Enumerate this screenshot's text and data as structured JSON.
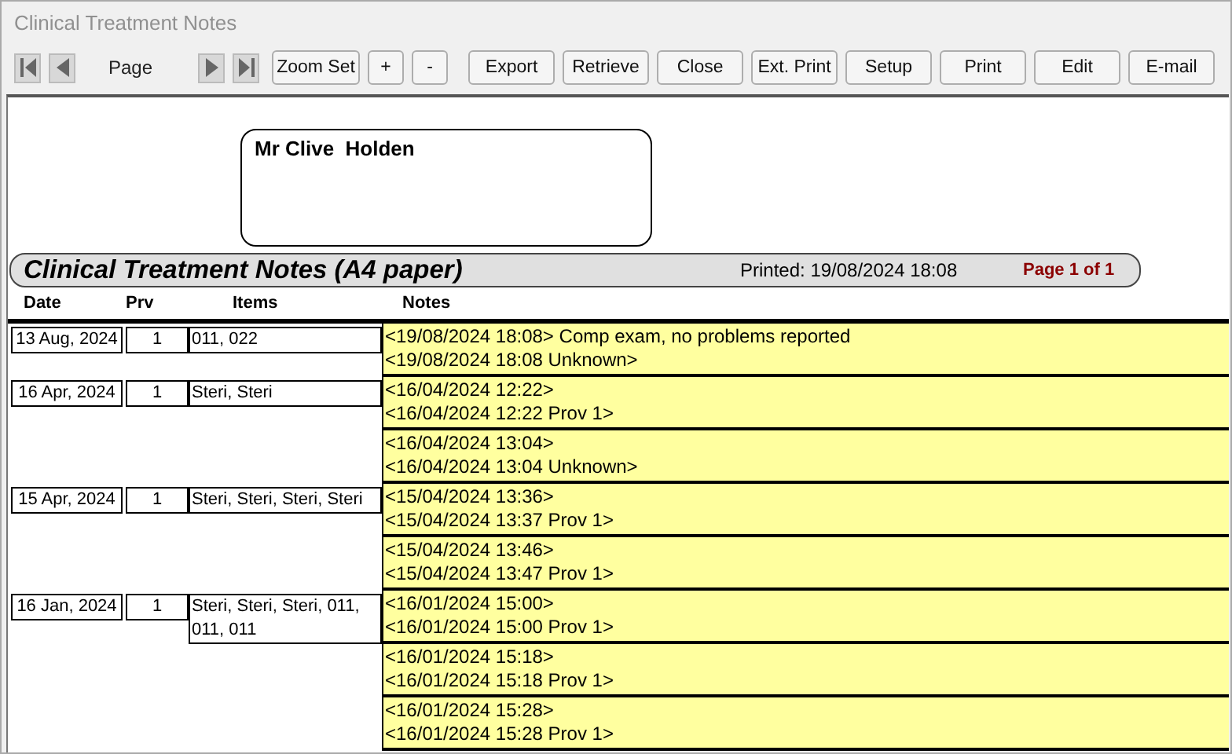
{
  "window": {
    "title": "Clinical Treatment Notes"
  },
  "toolbar": {
    "page_label": "Page",
    "zoom_buttons": [
      "Zoom Set",
      "+",
      "-"
    ],
    "buttons": [
      "Export",
      "Retrieve",
      "Close",
      "Ext. Print",
      "Setup",
      "Print",
      "Edit",
      "E-mail"
    ]
  },
  "patient": {
    "name": "Mr Clive  Holden"
  },
  "report": {
    "title": "Clinical Treatment Notes (A4 paper)",
    "printed": "Printed: 19/08/2024 18:08",
    "page": "Page 1 of 1"
  },
  "table": {
    "columns": [
      "Date",
      "Prv",
      "Items",
      "Notes"
    ],
    "rows": [
      {
        "date": "13 Aug, 2024",
        "prv": "1",
        "items": "011, 022",
        "notes": [
          [
            "<19/08/2024 18:08> Comp exam, no problems reported",
            "<19/08/2024 18:08  Unknown>"
          ]
        ]
      },
      {
        "date": "16 Apr, 2024",
        "prv": "1",
        "items": "Steri, Steri",
        "notes": [
          [
            "<16/04/2024 12:22>",
            "<16/04/2024 12:22 Prov 1>"
          ],
          [
            "<16/04/2024 13:04>",
            "<16/04/2024 13:04  Unknown>"
          ]
        ]
      },
      {
        "date": "15 Apr, 2024",
        "prv": "1",
        "items": "Steri, Steri, Steri, Steri",
        "notes": [
          [
            "<15/04/2024 13:36>",
            "<15/04/2024 13:37 Prov 1>"
          ],
          [
            "<15/04/2024 13:46>",
            "<15/04/2024 13:47 Prov 1>"
          ]
        ]
      },
      {
        "date": "16 Jan, 2024",
        "prv": "1",
        "items": "Steri, Steri, Steri, 011, 011, 011",
        "notes": [
          [
            "<16/01/2024 15:00>",
            "<16/01/2024 15:00 Prov 1>"
          ],
          [
            "<16/01/2024 15:18>",
            "<16/01/2024 15:18 Prov 1>"
          ],
          [
            "<16/01/2024 15:28>",
            "<16/01/2024 15:28 Prov 1>"
          ]
        ]
      }
    ]
  }
}
